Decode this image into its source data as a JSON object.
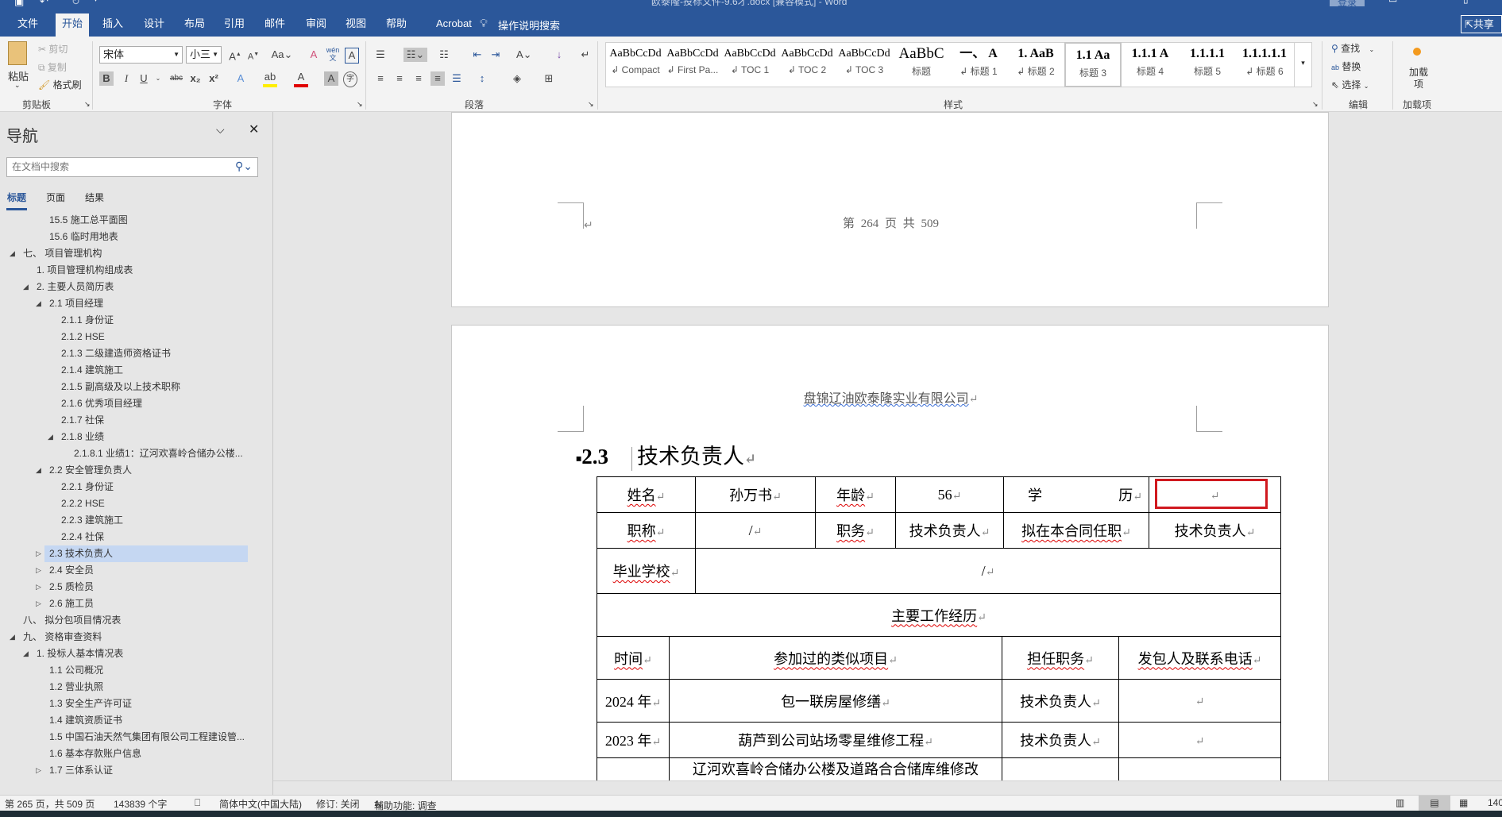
{
  "window": {
    "title": "欧泰隆-投标文件-9.6才.docx [兼容模式] - Word",
    "signin_label": "登录",
    "share_label": "共享"
  },
  "tabs": [
    "文件",
    "开始",
    "插入",
    "设计",
    "布局",
    "引用",
    "邮件",
    "审阅",
    "视图",
    "帮助",
    "Acrobat"
  ],
  "tell_me": "操作说明搜索",
  "ribbon": {
    "clipboard": {
      "paste": "粘贴",
      "cut": "剪切",
      "copy": "复制",
      "format_painter": "格式刷",
      "label": "剪贴板"
    },
    "font": {
      "name": "宋体",
      "size": "小三",
      "label": "字体",
      "change_case": "Aa",
      "bold": "B",
      "italic": "I",
      "underline": "U",
      "strike": "abc",
      "sub": "x₂",
      "sup": "x²",
      "phonetic": "wén"
    },
    "paragraph": {
      "label": "段落"
    },
    "styles": {
      "label": "样式",
      "items": [
        {
          "preview": "AaBbCcDd",
          "name": "↲ Compact"
        },
        {
          "preview": "AaBbCcDd",
          "name": "↲ First Pa..."
        },
        {
          "preview": "AaBbCcDd",
          "name": "↲ TOC 1"
        },
        {
          "preview": "AaBbCcDd",
          "name": "↲ TOC 2"
        },
        {
          "preview": "AaBbCcDd",
          "name": "↲ TOC 3"
        },
        {
          "preview": "AaBbC",
          "name": "标题"
        },
        {
          "preview": "一、 A",
          "name": "↲ 标题 1"
        },
        {
          "preview": "1. AaB",
          "name": "↲ 标题 2"
        },
        {
          "preview": "1.1 Aa",
          "name": "标题 3"
        },
        {
          "preview": "1.1.1 A",
          "name": "标题 4"
        },
        {
          "preview": "1.1.1.1",
          "name": "标题 5"
        },
        {
          "preview": "1.1.1.1.1",
          "name": "↲ 标题 6"
        }
      ],
      "selected_index": 8
    },
    "editing": {
      "find": "查找",
      "replace": "替换",
      "select": "选择",
      "label": "编辑"
    },
    "addins": {
      "button": "加载项",
      "label": "加载项"
    }
  },
  "nav": {
    "title": "导航",
    "search_placeholder": "在文档中搜索",
    "tabs": [
      "标题",
      "页面",
      "结果"
    ],
    "items": [
      {
        "text": "15.5 施工总平面图",
        "level": 2,
        "arrow": ""
      },
      {
        "text": "15.6 临时用地表",
        "level": 2,
        "arrow": ""
      },
      {
        "text": "七、  项目管理机构",
        "level": 0,
        "arrow": "expanded"
      },
      {
        "text": "1. 项目管理机构组成表",
        "level": 1,
        "arrow": ""
      },
      {
        "text": "2. 主要人员简历表",
        "level": 1,
        "arrow": "expanded"
      },
      {
        "text": "2.1 项目经理",
        "level": 2,
        "arrow": "expanded"
      },
      {
        "text": "2.1.1 身份证",
        "level": 3,
        "arrow": ""
      },
      {
        "text": "2.1.2 HSE",
        "level": 3,
        "arrow": ""
      },
      {
        "text": "2.1.3 二级建造师资格证书",
        "level": 3,
        "arrow": ""
      },
      {
        "text": "2.1.4 建筑施工",
        "level": 3,
        "arrow": ""
      },
      {
        "text": "2.1.5 副高级及以上技术职称",
        "level": 3,
        "arrow": ""
      },
      {
        "text": "2.1.6 优秀项目经理",
        "level": 3,
        "arrow": ""
      },
      {
        "text": "2.1.7 社保",
        "level": 3,
        "arrow": ""
      },
      {
        "text": "2.1.8 业绩",
        "level": 3,
        "arrow": "expanded"
      },
      {
        "text": "2.1.8.1 业绩1：辽河欢喜岭合储办公楼...",
        "level": 4,
        "arrow": ""
      },
      {
        "text": "2.2 安全管理负责人",
        "level": 2,
        "arrow": "expanded"
      },
      {
        "text": "2.2.1 身份证",
        "level": 3,
        "arrow": ""
      },
      {
        "text": "2.2.2 HSE",
        "level": 3,
        "arrow": ""
      },
      {
        "text": "2.2.3 建筑施工",
        "level": 3,
        "arrow": ""
      },
      {
        "text": "2.2.4 社保",
        "level": 3,
        "arrow": ""
      },
      {
        "text": "2.3 技术负责人",
        "level": 2,
        "arrow": "collapsed",
        "selected": true
      },
      {
        "text": "2.4 安全员",
        "level": 2,
        "arrow": "collapsed"
      },
      {
        "text": "2.5 质检员",
        "level": 2,
        "arrow": "collapsed"
      },
      {
        "text": "2.6 施工员",
        "level": 2,
        "arrow": "collapsed"
      },
      {
        "text": "八、  拟分包项目情况表",
        "level": 0,
        "arrow": ""
      },
      {
        "text": "九、  资格审查资料",
        "level": 0,
        "arrow": "expanded"
      },
      {
        "text": "1. 投标人基本情况表",
        "level": 1,
        "arrow": "expanded"
      },
      {
        "text": "1.1 公司概况",
        "level": 2,
        "arrow": ""
      },
      {
        "text": "1.2 营业执照",
        "level": 2,
        "arrow": ""
      },
      {
        "text": "1.3 安全生产许可证",
        "level": 2,
        "arrow": ""
      },
      {
        "text": "1.4 建筑资质证书",
        "level": 2,
        "arrow": ""
      },
      {
        "text": "1.5 中国石油天然气集团有限公司工程建设管...",
        "level": 2,
        "arrow": ""
      },
      {
        "text": "1.6 基本存款账户信息",
        "level": 2,
        "arrow": ""
      },
      {
        "text": "1.7 三体系认证",
        "level": 2,
        "arrow": "collapsed"
      }
    ]
  },
  "document": {
    "footer_prev": "第 264 页 共 509",
    "header": "盘锦辽油欧泰隆实业有限公司",
    "heading_number": "2.3",
    "heading_text": "技术负责人",
    "info": {
      "name_label": "姓名",
      "name": "孙万书",
      "age_label": "年龄",
      "age": "56",
      "edu_label_1": "学",
      "edu_label_2": "历",
      "edu": "",
      "title_label": "职称",
      "title": "/",
      "post_label": "职务",
      "post": "技术负责人",
      "contract_label": "拟在本合同任职",
      "contract": "技术负责人",
      "school_label": "毕业学校",
      "school": "/"
    },
    "experience_title": "主要工作经历",
    "experience_headers": [
      "时间",
      "参加过的类似项目",
      "担任职务",
      "发包人及联系电话"
    ],
    "experience_rows": [
      [
        "2024 年",
        "包一联房屋修缮",
        "技术负责人",
        ""
      ],
      [
        "2023 年",
        "葫芦到公司站场零星维修工程",
        "技术负责人",
        ""
      ],
      [
        "",
        "辽河欢喜岭合储办公楼及道路合合储库维修改",
        "",
        ""
      ]
    ]
  },
  "status": {
    "page": "第 265 页，共 509 页",
    "words": "143839 个字",
    "language": "简体中文(中国大陆)",
    "track_changes": "修订: 关闭",
    "accessibility": "辅助功能: 调查",
    "zoom": "140"
  },
  "colors": {
    "brand": "#2b579a",
    "selected_nav": "#c5d7f2",
    "highlight_box": "#d0191f"
  }
}
